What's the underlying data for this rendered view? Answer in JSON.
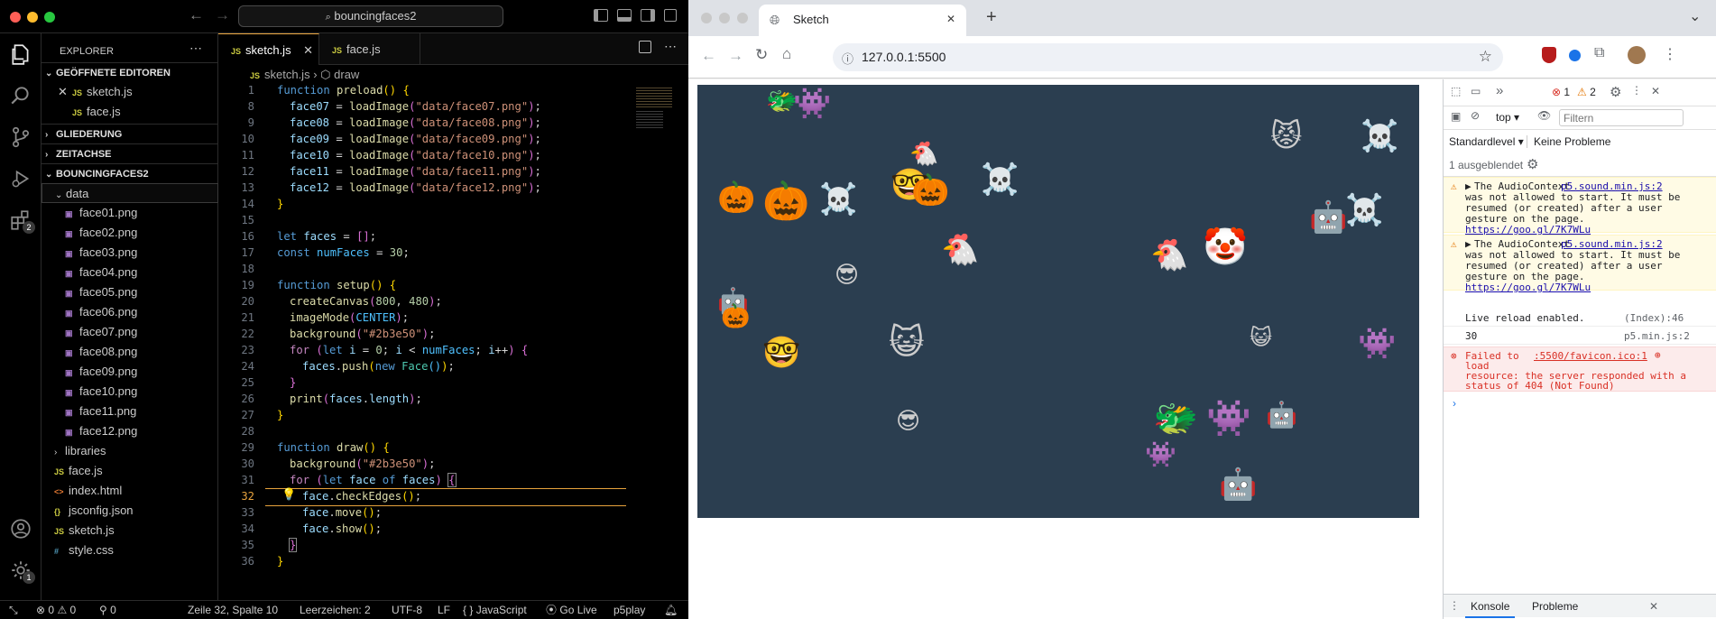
{
  "vscode": {
    "search_text": "bouncingfaces2",
    "explorer_title": "EXPLORER",
    "sections": {
      "open_editors": "GEÖFFNETE EDITOREN",
      "outline": "GLIEDERUNG",
      "timeline": "ZEITACHSE",
      "project": "BOUNCINGFACES2"
    },
    "open_editors": [
      "sketch.js",
      "face.js"
    ],
    "data_folder": "data",
    "data_files": [
      "face01.png",
      "face02.png",
      "face03.png",
      "face04.png",
      "face05.png",
      "face06.png",
      "face07.png",
      "face08.png",
      "face09.png",
      "face10.png",
      "face11.png",
      "face12.png"
    ],
    "root_files": [
      "libraries",
      "face.js",
      "index.html",
      "jsconfig.json",
      "sketch.js",
      "style.css"
    ],
    "tabs": [
      "sketch.js",
      "face.js"
    ],
    "breadcrumb": {
      "file": "sketch.js",
      "symbol": "draw"
    },
    "activity_badges": {
      "extensions": "2",
      "settings": "1"
    },
    "status": {
      "problems": "0",
      "warnings": "0",
      "ports": "0",
      "position": "Zeile 32, Spalte 10",
      "spaces": "Leerzeichen: 2",
      "encoding": "UTF-8",
      "eol": "LF",
      "language": "JavaScript",
      "golive": "Go Live",
      "extension": "p5play"
    }
  },
  "browser": {
    "tab_title": "Sketch",
    "url": "127.0.0.1:5500",
    "canvas_bg": "#2b3e50",
    "devtools": {
      "errors": "1",
      "warnings": "2",
      "context": "top",
      "filter_placeholder": "Filtern",
      "level": "Standardlevel",
      "no_issues": "Keine Probleme",
      "hidden": "1 ausgeblendet",
      "msgs": {
        "audio1_prefix": "The AudioContext",
        "audio1_src": "p5.sound.min.js:2",
        "audio_body_1": "was not allowed to start. It must be",
        "audio_body_2": "resumed (or created) after a user",
        "audio_body_3": "gesture on the page.",
        "audio_link": "https://goo.gl/7K7WLu",
        "live_reload": "Live reload enabled.",
        "live_reload_src": "(Index):46",
        "count_value": "30",
        "count_src": "p5.min.js:2",
        "error_prefix": "Failed to",
        "error_src": ":5500/favicon.ico:1",
        "error_l2": "load",
        "error_l3": "resource: the server responded with a",
        "error_l4": "status of 404 (Not Found)"
      },
      "bottom_tabs": [
        "Konsole",
        "Probleme"
      ]
    }
  }
}
